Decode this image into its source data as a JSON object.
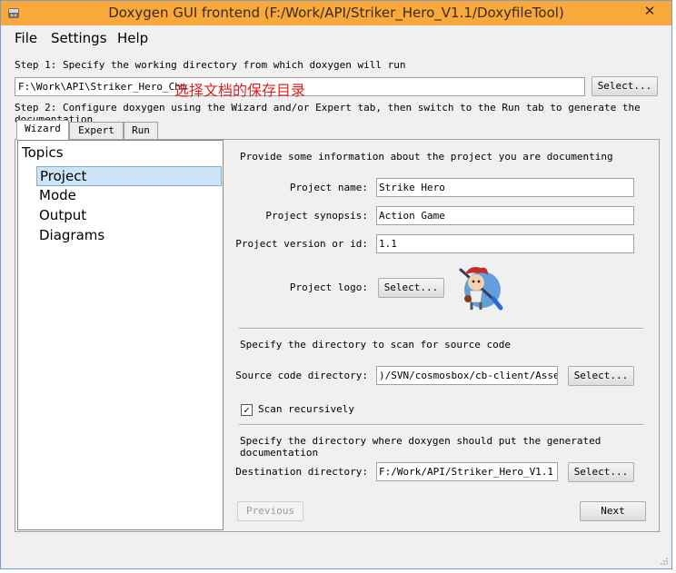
{
  "window": {
    "title": "Doxygen GUI frontend (F:/Work/API/Striker_Hero_V1.1/DoxyfileTool)",
    "close_symbol": "✕"
  },
  "menu": {
    "file": "File",
    "settings": "Settings",
    "help": "Help"
  },
  "step1": {
    "label": "Step 1: Specify the working directory from which doxygen will run",
    "directory_value": "F:\\Work\\API\\Striker_Hero_Chm",
    "note": "选择文档的保存目录",
    "select_button": "Select..."
  },
  "step2": {
    "label": "Step 2: Configure doxygen using the Wizard and/or Expert tab, then switch to the Run tab to generate the documentation"
  },
  "tabs": [
    {
      "label": "Wizard",
      "active": true
    },
    {
      "label": "Expert",
      "active": false
    },
    {
      "label": "Run",
      "active": false
    }
  ],
  "topics": {
    "header": "Topics",
    "items": [
      {
        "label": "Project",
        "selected": true
      },
      {
        "label": "Mode",
        "selected": false
      },
      {
        "label": "Output",
        "selected": false
      },
      {
        "label": "Diagrams",
        "selected": false
      }
    ]
  },
  "project": {
    "intro": "Provide some information about the project you are documenting",
    "name_label": "Project name:",
    "name_value": "Strike Hero",
    "synopsis_label": "Project synopsis:",
    "synopsis_value": "Action Game",
    "version_label": "Project version or id:",
    "version_value": "1.1",
    "logo_label": "Project logo:",
    "logo_button": "Select..."
  },
  "source": {
    "intro": "Specify the directory to scan for source code",
    "dir_label": "Source code directory:",
    "dir_value": ")/SVN/cosmosbox/cb-client/Assets",
    "select_button": "Select...",
    "recursive_label": "Scan recursively",
    "recursive_checked": true,
    "check_mark": "✓"
  },
  "destination": {
    "intro": "Specify the directory where doxygen should put the generated documentation",
    "dir_label": "Destination directory:",
    "dir_value": "F:/Work/API/Striker_Hero_V1.1",
    "select_button": "Select..."
  },
  "nav": {
    "previous": "Previous",
    "next": "Next"
  },
  "colors": {
    "titlebar": "#f9a93b",
    "note_red": "#e02020",
    "selection": "#cde4f7"
  },
  "icons": {
    "app": "doxygen-app-icon",
    "logo": "project-logo-character"
  }
}
